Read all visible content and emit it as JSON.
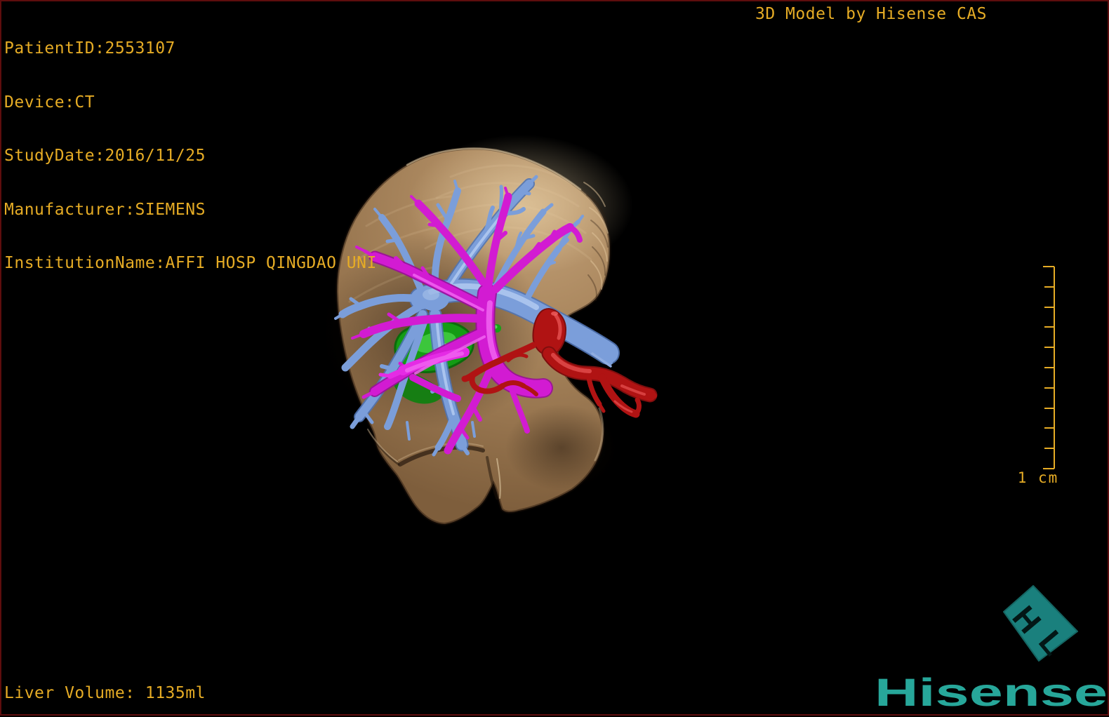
{
  "header": {
    "lines": [
      "PatientID:2553107",
      "Device:CT",
      "StudyDate:2016/11/25",
      "Manufacturer:SIEMENS",
      "InstitutionName:AFFI HOSP QINGDAO UNI"
    ]
  },
  "title_bar": {
    "text": "3D Model by Hisense CAS"
  },
  "measurements": {
    "liver_volume": "Liver Volume: 1135ml"
  },
  "scale_bar": {
    "label": "1 cm",
    "interval_count": 10
  },
  "branding": {
    "logotype": "Hisense",
    "emblem_top_letter": "H",
    "emblem_bottom_letter": "L"
  },
  "colors": {
    "background": "#000000",
    "frame_border": "#5E0D0D",
    "annotation_gold": "#E6AC25",
    "liver_tan": "#A8835B",
    "hepatic_vein_blue": "#7B9EDA",
    "portal_vein_magenta": "#D21BD2",
    "hepatic_artery_red": "#B01313",
    "gallbladder_green": "#149C14",
    "brand_teal": "#27A79A",
    "emblem_teal": "#1A807D"
  }
}
